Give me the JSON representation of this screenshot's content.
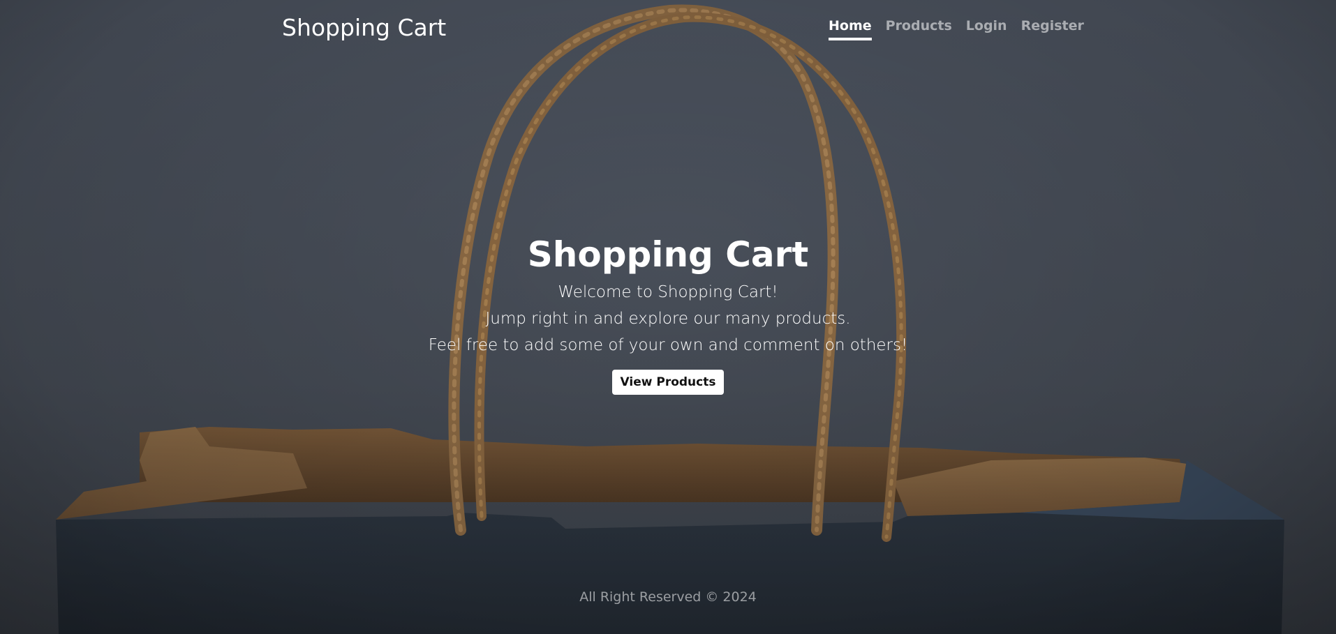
{
  "navbar": {
    "brand": "Shopping Cart",
    "links": [
      {
        "label": "Home",
        "active": true
      },
      {
        "label": "Products",
        "active": false
      },
      {
        "label": "Login",
        "active": false
      },
      {
        "label": "Register",
        "active": false
      }
    ]
  },
  "hero": {
    "title": "Shopping Cart",
    "lines": [
      "Welcome to Shopping Cart!",
      "Jump right in and explore our many products.",
      "Feel free to add some of your own and comment on others!"
    ],
    "button_label": "View Products"
  },
  "footer": {
    "text": "All Right Reserved © 2024"
  },
  "colors": {
    "background": "#4a505b",
    "bag_body": "#2a323d",
    "paper": "#a07a4e",
    "handle": "#9a7346"
  },
  "background_image": "paper-shopping-bag-photo"
}
